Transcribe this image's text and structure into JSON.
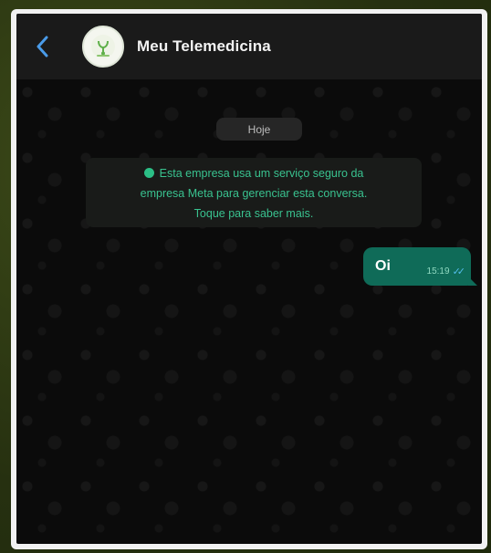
{
  "header": {
    "title": "Meu Telemedicina",
    "back_icon": "chevron-left-icon",
    "avatar_icon": "clinic-logo-icon"
  },
  "chat": {
    "date_label": "Hoje",
    "notice": {
      "line1": "Esta empresa usa um serviço seguro da",
      "line2": "empresa Meta para gerenciar esta conversa.",
      "line3": "Toque para saber mais."
    },
    "messages": [
      {
        "text": "Oi",
        "time": "15:19",
        "status": "read-double-check-icon"
      }
    ]
  },
  "colors": {
    "header_bg": "#1a1a1a",
    "chat_bg": "#0b0b0b",
    "accent_green": "#39c28f",
    "bubble_bg": "#0f6b58",
    "back_blue": "#4a9be8"
  }
}
